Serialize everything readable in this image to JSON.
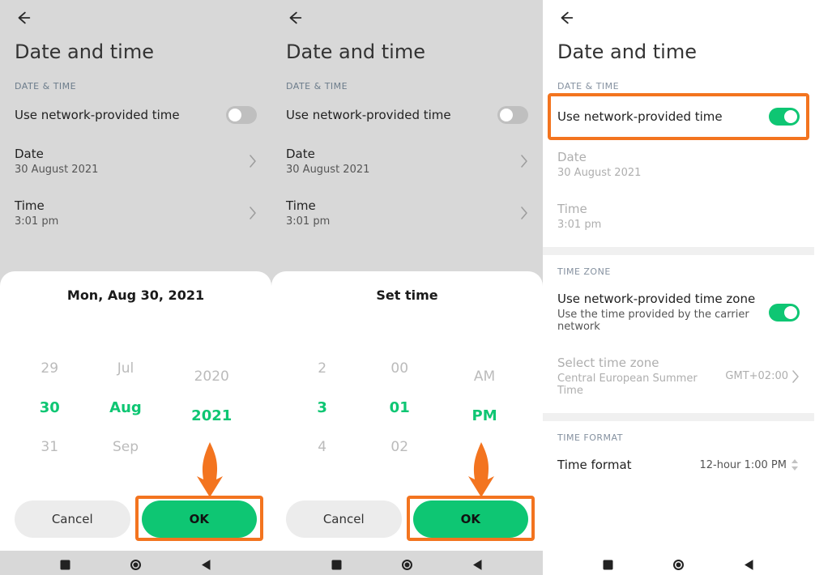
{
  "panel1": {
    "title": "Date and time",
    "section_label": "DATE & TIME",
    "network_time_label": "Use network-provided time",
    "network_time_on": false,
    "date_label": "Date",
    "date_value": "30 August 2021",
    "time_label": "Time",
    "time_value": "3:01 pm",
    "sheet_title": "Mon, Aug 30, 2021",
    "picker": {
      "day": [
        "29",
        "30",
        "31"
      ],
      "month": [
        "Jul",
        "Aug",
        "Sep"
      ],
      "year": [
        "2020",
        "2021",
        ""
      ]
    },
    "cancel": "Cancel",
    "ok": "OK"
  },
  "panel2": {
    "title": "Date and time",
    "section_label": "DATE & TIME",
    "network_time_label": "Use network-provided time",
    "network_time_on": false,
    "date_label": "Date",
    "date_value": "30 August 2021",
    "time_label": "Time",
    "time_value": "3:01 pm",
    "sheet_title": "Set time",
    "picker": {
      "hour": [
        "2",
        "3",
        "4"
      ],
      "minute": [
        "00",
        "01",
        "02"
      ],
      "ampm": [
        "AM",
        "PM",
        ""
      ]
    },
    "cancel": "Cancel",
    "ok": "OK"
  },
  "panel3": {
    "title": "Date and time",
    "section_date": "DATE & TIME",
    "section_zone": "TIME ZONE",
    "section_format": "TIME FORMAT",
    "network_time_label": "Use network-provided time",
    "network_time_on": true,
    "date_label": "Date",
    "date_value": "30 August 2021",
    "time_label": "Time",
    "time_value": "3:01 pm",
    "zone_label": "Use network-provided time zone",
    "zone_sub": "Use the time provided by the carrier network",
    "zone_on": true,
    "select_zone_label": "Select time zone",
    "select_zone_sub": "Central European Summer Time",
    "select_zone_val": "GMT+02:00",
    "format_label": "Time format",
    "format_val": "12-hour 1:00 PM"
  }
}
